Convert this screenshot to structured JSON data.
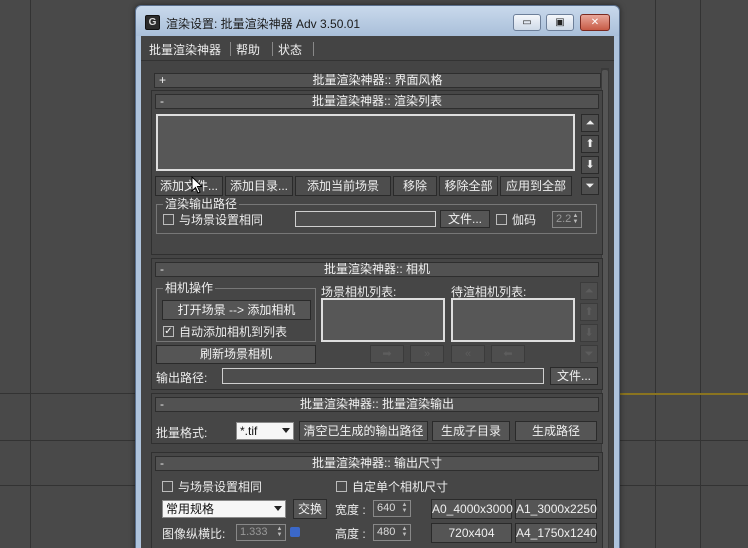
{
  "window": {
    "title": "渲染设置: 批量渲染神器 Adv 3.50.01",
    "app_icon": "G",
    "min_glyph": "▭",
    "max_glyph": "▣",
    "close_glyph": "✕"
  },
  "menu": [
    "批量渲染神器",
    "帮助",
    "状态"
  ],
  "rollups": {
    "ui_style": {
      "sign": "+",
      "title": "批量渲染神器:: 界面风格"
    },
    "render_list": {
      "sign": "-",
      "title": "批量渲染神器:: 渲染列表"
    },
    "camera": {
      "sign": "-",
      "title": "批量渲染神器:: 相机"
    },
    "batch_output": {
      "sign": "-",
      "title": "批量渲染神器:: 批量渲染输出"
    },
    "output_size": {
      "sign": "-",
      "title": "批量渲染神器:: 输出尺寸"
    }
  },
  "render_list": {
    "buttons": [
      "添加文件...",
      "添加目录...",
      "添加当前场景",
      "移除",
      "移除全部",
      "应用到全部"
    ],
    "side_icons": [
      "double-up-icon",
      "up-arrow-icon",
      "down-arrow-icon",
      "double-down-icon"
    ],
    "output_group": {
      "title": "渲染输出路径",
      "same_as_scene_label": "与场景设置相同",
      "same_as_scene_checked": false,
      "file_button": "文件...",
      "gamma_label": "伽码",
      "gamma_checked": false,
      "gamma_value": "2.2"
    }
  },
  "camera": {
    "ops_group_title": "相机操作",
    "open_scene_button": "打开场景 --> 添加相机",
    "auto_add_label": "自动添加相机到列表",
    "auto_add_checked": true,
    "refresh_button": "刷新场景相机",
    "scene_list_label": "场景相机列表:",
    "render_list_label": "待渲相机列表:",
    "output_path_label": "输出路径:",
    "file_button": "文件..."
  },
  "batch_output": {
    "format_label": "批量格式:",
    "format_value": "*.tif",
    "clear_button": "清空已生成的输出路径",
    "subdir_button": "生成子目录",
    "path_button": "生成路径"
  },
  "output_size": {
    "same_as_scene_label": "与场景设置相同",
    "same_as_scene_checked": false,
    "custom_single_label": "自定单个相机尺寸",
    "custom_single_checked": false,
    "preset_value": "常用规格",
    "swap_button": "交换",
    "width_label": "宽度 :",
    "width_value": "640",
    "height_label": "高度 :",
    "height_value": "480",
    "aspect_label": "图像纵横比:",
    "aspect_value": "1.333",
    "presets": [
      "A0_4000x3000",
      "A1_3000x2250",
      "720x404",
      "A4_1750x1240"
    ]
  }
}
